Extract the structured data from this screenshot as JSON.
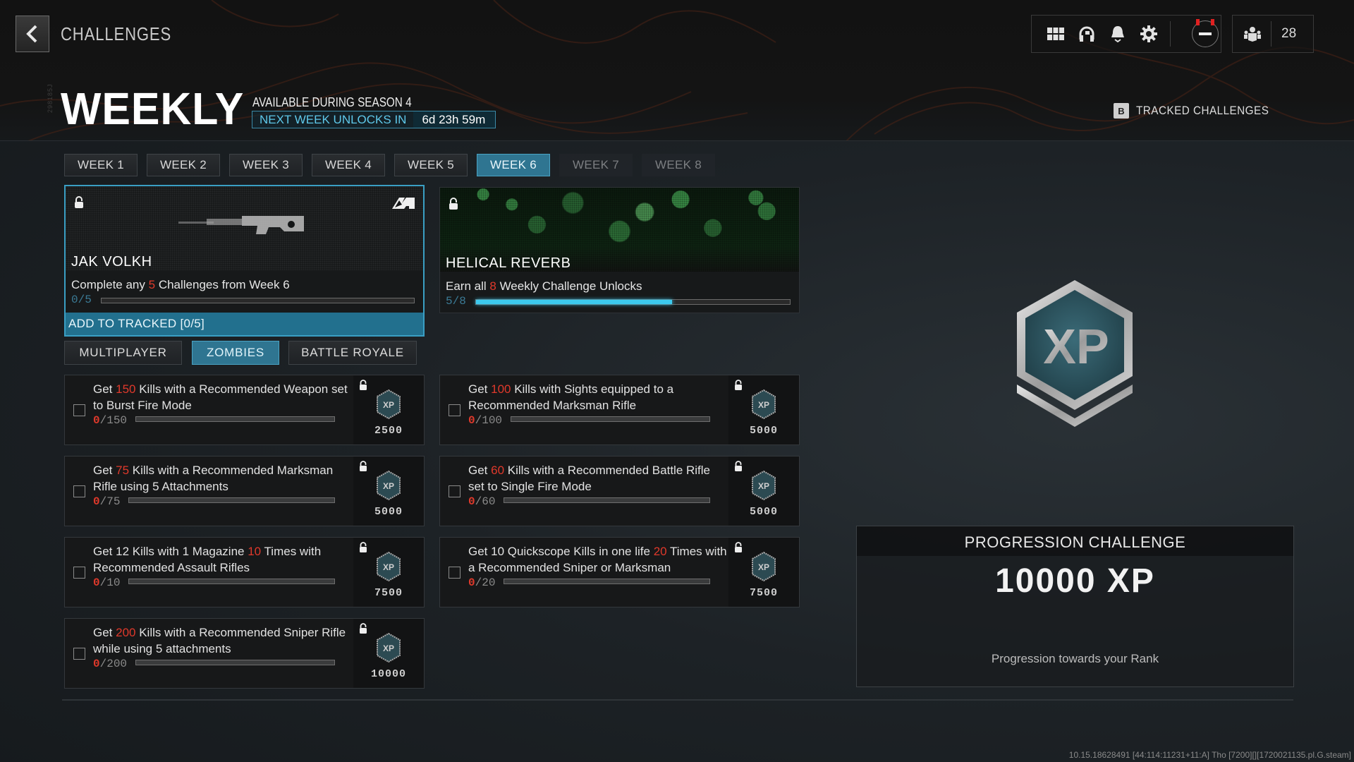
{
  "header": {
    "back_label": "back",
    "title": "CHALLENGES",
    "serial": "298185J",
    "page_title": "WEEKLY",
    "season_text": "AVAILABLE DURING SEASON 4",
    "timer_label": "NEXT WEEK UNLOCKS IN",
    "timer_value": "6d 23h 59m",
    "icons": [
      "grid-icon",
      "headset-icon",
      "bell-icon",
      "gear-icon",
      "status-icon"
    ],
    "party_count": "28",
    "tracked_key": "B",
    "tracked_label": "TRACKED CHALLENGES"
  },
  "weeks": [
    {
      "label": "WEEK 1",
      "state": "normal"
    },
    {
      "label": "WEEK 2",
      "state": "normal"
    },
    {
      "label": "WEEK 3",
      "state": "normal"
    },
    {
      "label": "WEEK 4",
      "state": "normal"
    },
    {
      "label": "WEEK 5",
      "state": "normal"
    },
    {
      "label": "WEEK 6",
      "state": "active"
    },
    {
      "label": "WEEK 7",
      "state": "locked"
    },
    {
      "label": "WEEK 8",
      "state": "locked"
    }
  ],
  "rewards": [
    {
      "name": "JAK VOLKH",
      "desc_pre": "Complete any ",
      "desc_num": "5",
      "desc_post": " Challenges from Week 6",
      "progress_text": "0/5",
      "progress": 0.0,
      "track_button": "ADD TO TRACKED [0/5]"
    },
    {
      "name": "HELICAL REVERB",
      "desc_pre": "Earn all ",
      "desc_num": "8",
      "desc_post": " Weekly Challenge Unlocks",
      "progress_text": "5/8",
      "progress": 0.625
    }
  ],
  "modes": [
    {
      "label": "MULTIPLAYER",
      "active": false
    },
    {
      "label": "ZOMBIES",
      "active": true
    },
    {
      "label": "BATTLE ROYALE",
      "active": false
    }
  ],
  "challenges": [
    {
      "pre": "Get ",
      "num": "150",
      "post": " Kills with a Recommended Weapon set to Burst Fire Mode",
      "current": "0",
      "total": "/150",
      "progress": 0,
      "xp": "2500"
    },
    {
      "pre": "Get ",
      "num": "100",
      "post": " Kills with Sights equipped to a Recommended Marksman Rifle",
      "current": "0",
      "total": "/100",
      "progress": 0,
      "xp": "5000"
    },
    {
      "pre": "Get ",
      "num": "75",
      "post": " Kills with a Recommended Marksman Rifle using 5 Attachments",
      "current": "0",
      "total": "/75",
      "progress": 0,
      "xp": "5000"
    },
    {
      "pre": "Get ",
      "num": "60",
      "post": " Kills with a Recommended Battle Rifle set to Single Fire Mode",
      "current": "0",
      "total": "/60",
      "progress": 0,
      "xp": "5000"
    },
    {
      "pre": "Get 12 Kills with 1 Magazine ",
      "num": "10",
      "post": " Times with Recommended Assault Rifles",
      "current": "0",
      "total": "/10",
      "progress": 0,
      "xp": "7500"
    },
    {
      "pre": "Get 10 Quickscope Kills in one life ",
      "num": "20",
      "post": " Times with a Recommended Sniper or Marksman",
      "current": "0",
      "total": "/20",
      "progress": 0,
      "xp": "7500"
    },
    {
      "pre": "Get ",
      "num": "200",
      "post": " Kills with a Recommended Sniper Rifle while using 5 attachments",
      "current": "0",
      "total": "/200",
      "progress": 0,
      "xp": "10000"
    }
  ],
  "progression": {
    "badge_text": "XP",
    "title": "PROGRESSION CHALLENGE",
    "amount": "10000 XP",
    "subtitle": "Progression towards your Rank"
  },
  "version": "10.15.18628491 [44:114:11231+11:A] Tho [7200][][1720021135.pl.G.steam]",
  "colors": {
    "accent": "#2f7591",
    "accent_bright": "#3cc9ee",
    "highlight_red": "#e0392b"
  }
}
